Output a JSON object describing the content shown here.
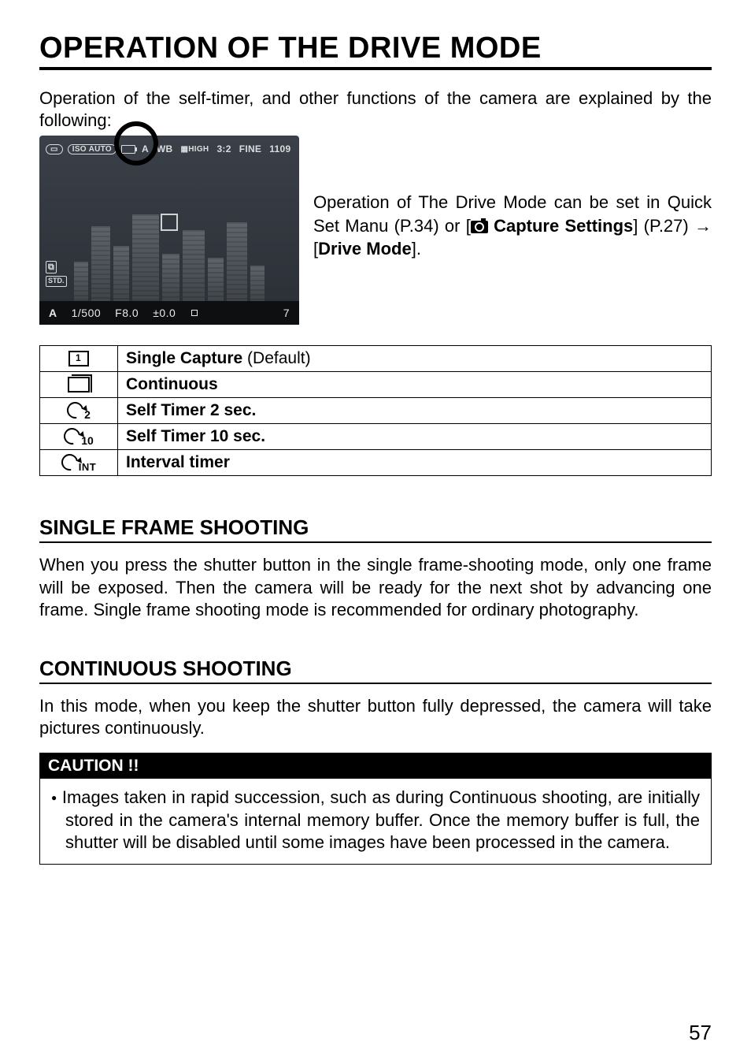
{
  "title": "OPERATION OF THE DRIVE MODE",
  "intro": "Operation of the self-timer, and other functions of the camera are explained by the following:",
  "figure_side_text": {
    "line1": "Operation of The Drive Mode can be set in Quick Set Manu (P.34) or [",
    "capture_label": " Capture Settings",
    "line2": "] (P.27) → [",
    "drive_label": "Drive Mode",
    "line3": "]."
  },
  "camera_top": {
    "drive_icon_name": "single-frame-icon",
    "iso": "ISO AUTO",
    "af": "A",
    "wb": "WB",
    "quality": "HIGH",
    "ratio": "3:2",
    "format": "FINE",
    "remaining": "1109"
  },
  "camera_left": {
    "badge1": "⧉",
    "badge2": "STD."
  },
  "camera_bottom": {
    "mode": "A",
    "shutter": "1/500",
    "aperture": "F8.0",
    "ev": "±0.0",
    "count": "7"
  },
  "drive_table": [
    {
      "icon": "single",
      "label_bold": "Single Capture",
      "label_rest": " (Default)"
    },
    {
      "icon": "continuous",
      "label_bold": "Continuous",
      "label_rest": ""
    },
    {
      "icon": "timer2",
      "label_bold": "Self Timer 2 sec.",
      "label_rest": ""
    },
    {
      "icon": "timer10",
      "label_bold": "Self Timer 10 sec.",
      "label_rest": ""
    },
    {
      "icon": "interval",
      "label_bold": "Interval timer",
      "label_rest": ""
    }
  ],
  "sections": {
    "single": {
      "heading": "SINGLE FRAME SHOOTING",
      "body": "When you press the shutter button in the single frame-shooting mode, only one frame will be exposed. Then the camera will be ready for the next shot by advancing one frame. Single frame shooting mode is recommended for ordinary photography."
    },
    "continuous": {
      "heading": "CONTINUOUS SHOOTING",
      "body": "In this mode, when you keep the shutter button fully depressed, the camera will take pictures continuously."
    }
  },
  "caution": {
    "heading": "CAUTION !!",
    "item": "Images taken in rapid succession, such as during Continuous shooting, are initially stored in the camera's internal memory buffer. Once the memory buffer is full, the shutter will be disabled until some images have been processed in the camera."
  },
  "page_number": "57"
}
